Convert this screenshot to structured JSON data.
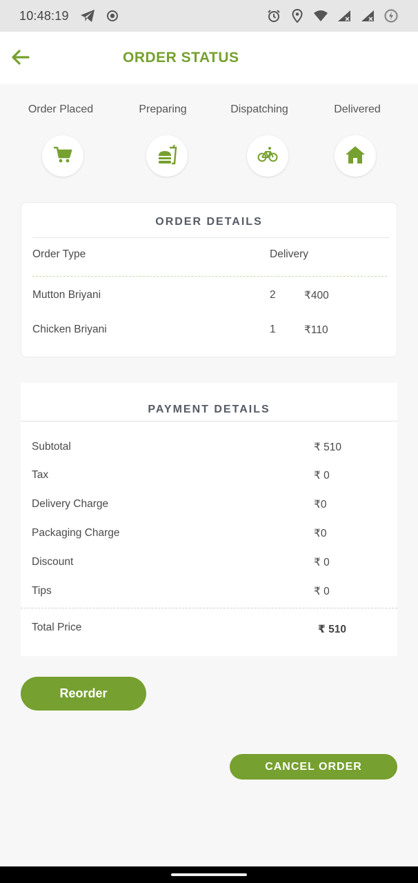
{
  "status_bar": {
    "time": "10:48:19",
    "left_icons": [
      "telegram-icon",
      "record-icon"
    ],
    "right_icons": [
      "alarm-icon",
      "location-icon",
      "wifi-icon",
      "signal-icon",
      "signal-icon",
      "battery-saver-icon"
    ]
  },
  "header": {
    "back_icon": "arrow-left-icon",
    "title": "ORDER STATUS"
  },
  "steps": [
    {
      "label": "Order Placed",
      "icon": "cart-icon"
    },
    {
      "label": "Preparing",
      "icon": "food-icon"
    },
    {
      "label": "Dispatching",
      "icon": "bicycle-icon"
    },
    {
      "label": "Delivered",
      "icon": "home-icon"
    }
  ],
  "order_details": {
    "title": "ORDER DETAILS",
    "order_type_label": "Order Type",
    "order_type_value": "Delivery",
    "items": [
      {
        "name": "Mutton Briyani",
        "qty": "2",
        "price": "₹400"
      },
      {
        "name": "Chicken Briyani",
        "qty": "1",
        "price": "₹110"
      }
    ]
  },
  "payment_details": {
    "title": "PAYMENT DETAILS",
    "rows": [
      {
        "label": "Subtotal",
        "value": "₹ 510"
      },
      {
        "label": "Tax",
        "value": "₹ 0"
      },
      {
        "label": "Delivery Charge",
        "value": "₹0"
      },
      {
        "label": "Packaging Charge",
        "value": "₹0"
      },
      {
        "label": "Discount",
        "value": "₹ 0"
      },
      {
        "label": "Tips",
        "value": "₹ 0"
      }
    ],
    "total_label": "Total Price",
    "total_value": "₹ 510"
  },
  "actions": {
    "reorder_label": "Reorder",
    "cancel_label": "CANCEL ORDER"
  },
  "colors": {
    "accent": "#76a02f",
    "status_bar_bg": "#e6e6e6",
    "page_bg": "#f7f7f7"
  }
}
